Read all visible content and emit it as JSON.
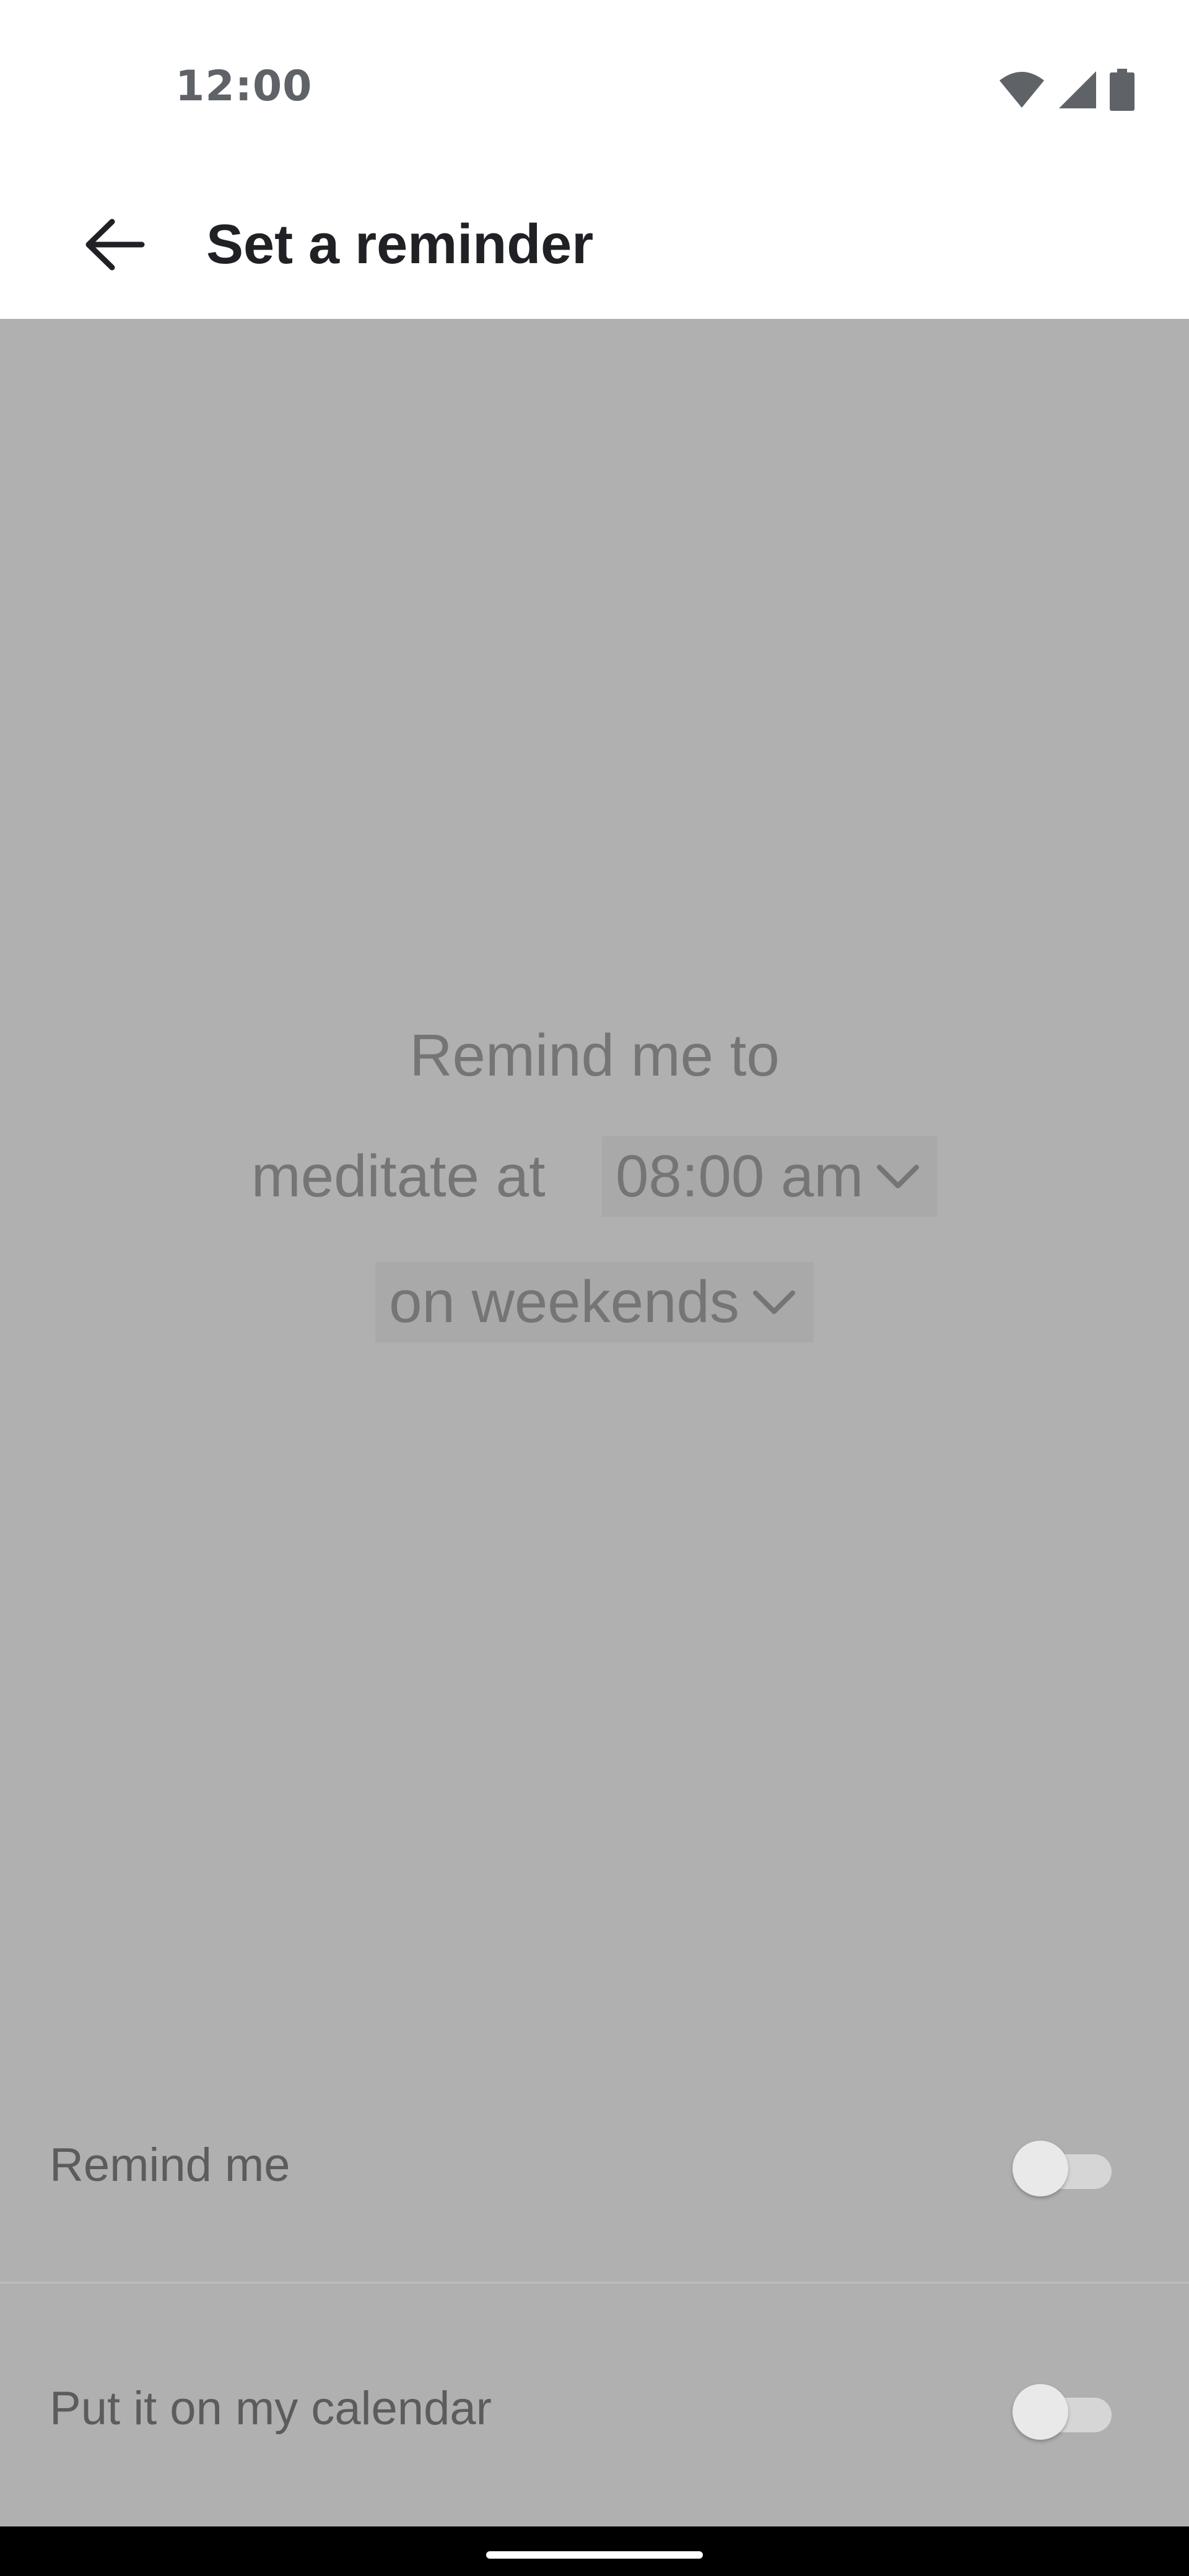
{
  "status_bar": {
    "time": "12:00",
    "icons": [
      "wifi-icon",
      "cellular-signal-icon",
      "battery-icon"
    ]
  },
  "app_bar": {
    "back_icon": "arrow-left-icon",
    "title": "Set a reminder"
  },
  "reminder_sentence": {
    "prefix_line": "Remind me to",
    "activity_text": "meditate at",
    "time_value": "08:00 am",
    "days_value": "on weekends",
    "dropdown_icon": "chevron-down-icon"
  },
  "settings": [
    {
      "label": "Remind me",
      "enabled": false
    },
    {
      "label": "Put it on my calendar",
      "enabled": false
    }
  ],
  "colors": {
    "overlay": "#b0b0b0",
    "text": "#757575",
    "title": "#202124"
  }
}
